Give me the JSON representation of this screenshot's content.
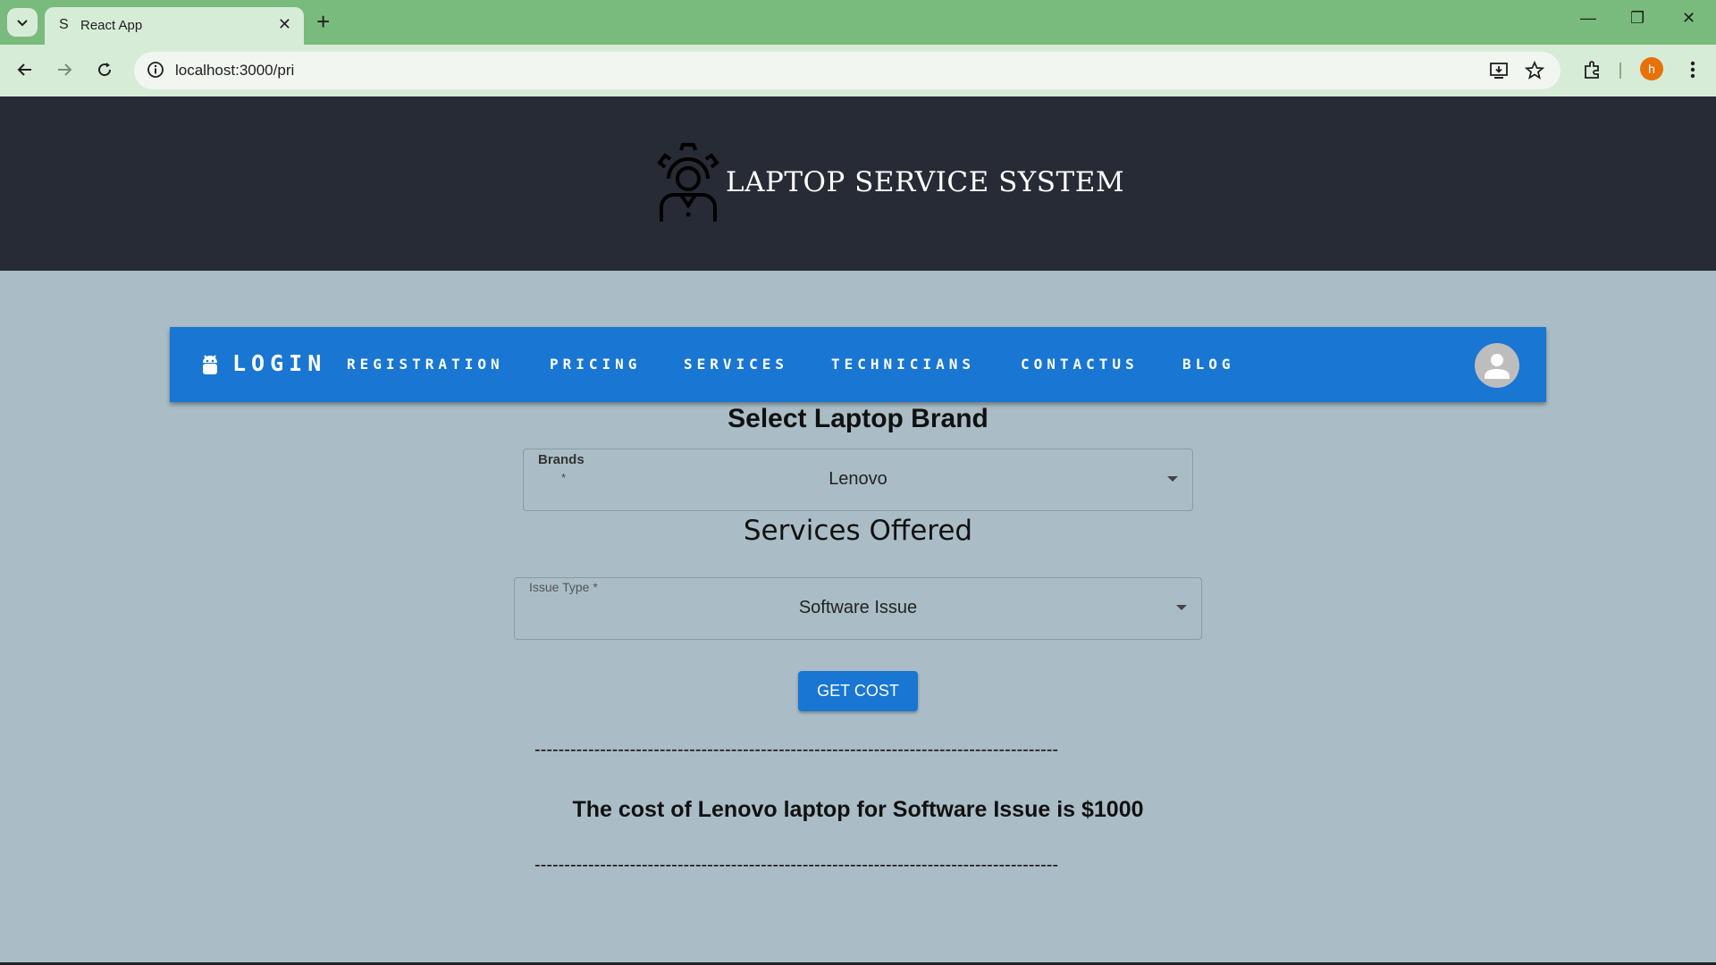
{
  "browser": {
    "tab_title": "React App",
    "tab_favicon": "S",
    "url": "localhost:3000/pri",
    "profile_initial": "h"
  },
  "header": {
    "title": "LAPTOP SERVICE SYSTEM"
  },
  "nav": {
    "brand": "LOGIN",
    "links": [
      "REGISTRATION",
      "PRICING",
      "SERVICES",
      "TECHNICIANS",
      "CONTACTUS",
      "BLOG"
    ]
  },
  "form": {
    "heading": "Select Laptop Brand",
    "brand_label": "Brands",
    "brand_required": "*",
    "brand_value": "Lenovo",
    "services_heading": "Services Offered",
    "issue_label": "Issue Type *",
    "issue_value": "Software Issue",
    "button_label": "GET COST"
  },
  "result": {
    "separator": "----------------------------------------------------------------------------------------",
    "text": "The cost of Lenovo laptop for Software Issue is $1000"
  },
  "colors": {
    "tabstrip": "#79bb7c",
    "header_bg": "#272b35",
    "appbar": "#1976d2",
    "page_bg": "#aabdc7"
  }
}
